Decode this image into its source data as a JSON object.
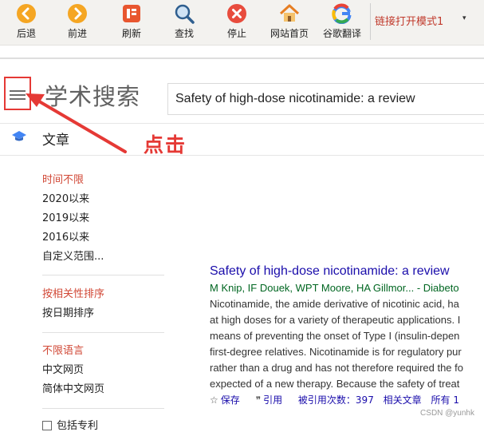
{
  "toolbar": {
    "buttons": [
      {
        "label": "后退",
        "icon": "back-arrow-icon"
      },
      {
        "label": "前进",
        "icon": "forward-arrow-icon"
      },
      {
        "label": "刷新",
        "icon": "refresh-icon"
      },
      {
        "label": "查找",
        "icon": "magnifier-icon"
      },
      {
        "label": "停止",
        "icon": "stop-icon"
      },
      {
        "label": "网站首页",
        "icon": "home-icon"
      },
      {
        "label": "谷歌翻译",
        "icon": "google-icon"
      }
    ],
    "mode_select": "链接打开模式1",
    "mode_arrow": "▾"
  },
  "header": {
    "logo": "学术搜索",
    "search_value": "Safety of high-dose nicotinamide: a review"
  },
  "annotation": {
    "click_text": "点击",
    "color": "#e53935"
  },
  "tab": {
    "label": "文章"
  },
  "sidebar": {
    "time": [
      "时间不限",
      "2020以来",
      "2019以来",
      "2016以来",
      "自定义范围..."
    ],
    "sort": [
      "按相关性排序",
      "按日期排序"
    ],
    "language": [
      "不限语言",
      "中文网页",
      "简体中文网页"
    ],
    "more": "包括专利"
  },
  "result": {
    "title": "Safety of high-dose nicotinamide: a review",
    "authors": "M Knip, IF Douek, WPT Moore, HA Gillmor... - Diabeto",
    "snippet": [
      "Nicotinamide, the amide derivative of nicotinic acid, ha",
      "at high doses for a variety of therapeutic applications. I",
      "means of preventing the onset of Type I (insulin-depen",
      "first-degree relatives. Nicotinamide is for regulatory pur",
      "rather than a drug and has not therefore required the fo",
      "expected of a new therapy. Because the safety of treat"
    ],
    "actions": {
      "save": "保存",
      "cite": "引用",
      "cited_by": "被引用次数：397",
      "related": "相关文章",
      "all_versions": "所有 1"
    }
  },
  "watermark": "CSDN @yunhk",
  "colors": {
    "accent_red": "#e53935",
    "link_blue": "#1a0dab",
    "author_green": "#006621",
    "active_filter": "#d14836"
  }
}
